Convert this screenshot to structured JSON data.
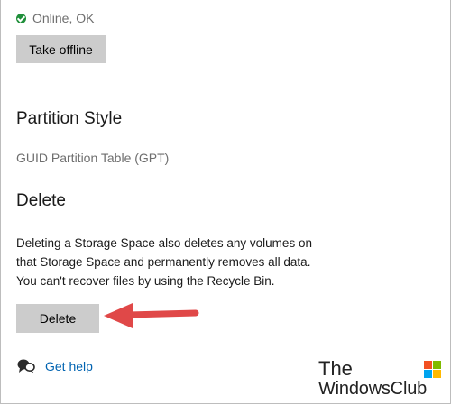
{
  "status": {
    "text": "Online, OK",
    "icon": "check-circle-icon",
    "color": "#1f8f3a"
  },
  "buttons": {
    "take_offline": "Take offline",
    "delete": "Delete"
  },
  "partition_style": {
    "heading": "Partition Style",
    "value": "GUID Partition Table (GPT)"
  },
  "delete_section": {
    "heading": "Delete",
    "description": "Deleting a Storage Space also deletes any volumes on that Storage Space and permanently removes all data. You can't recover files by using the Recycle Bin."
  },
  "help": {
    "label": "Get help",
    "icon": "help-chat-icon",
    "link_color": "#0063b1"
  },
  "annotation": {
    "arrow_icon": "red-arrow-icon",
    "arrow_color": "#e04848"
  },
  "watermark": {
    "line1": "The",
    "line2": "WindowsClub"
  }
}
